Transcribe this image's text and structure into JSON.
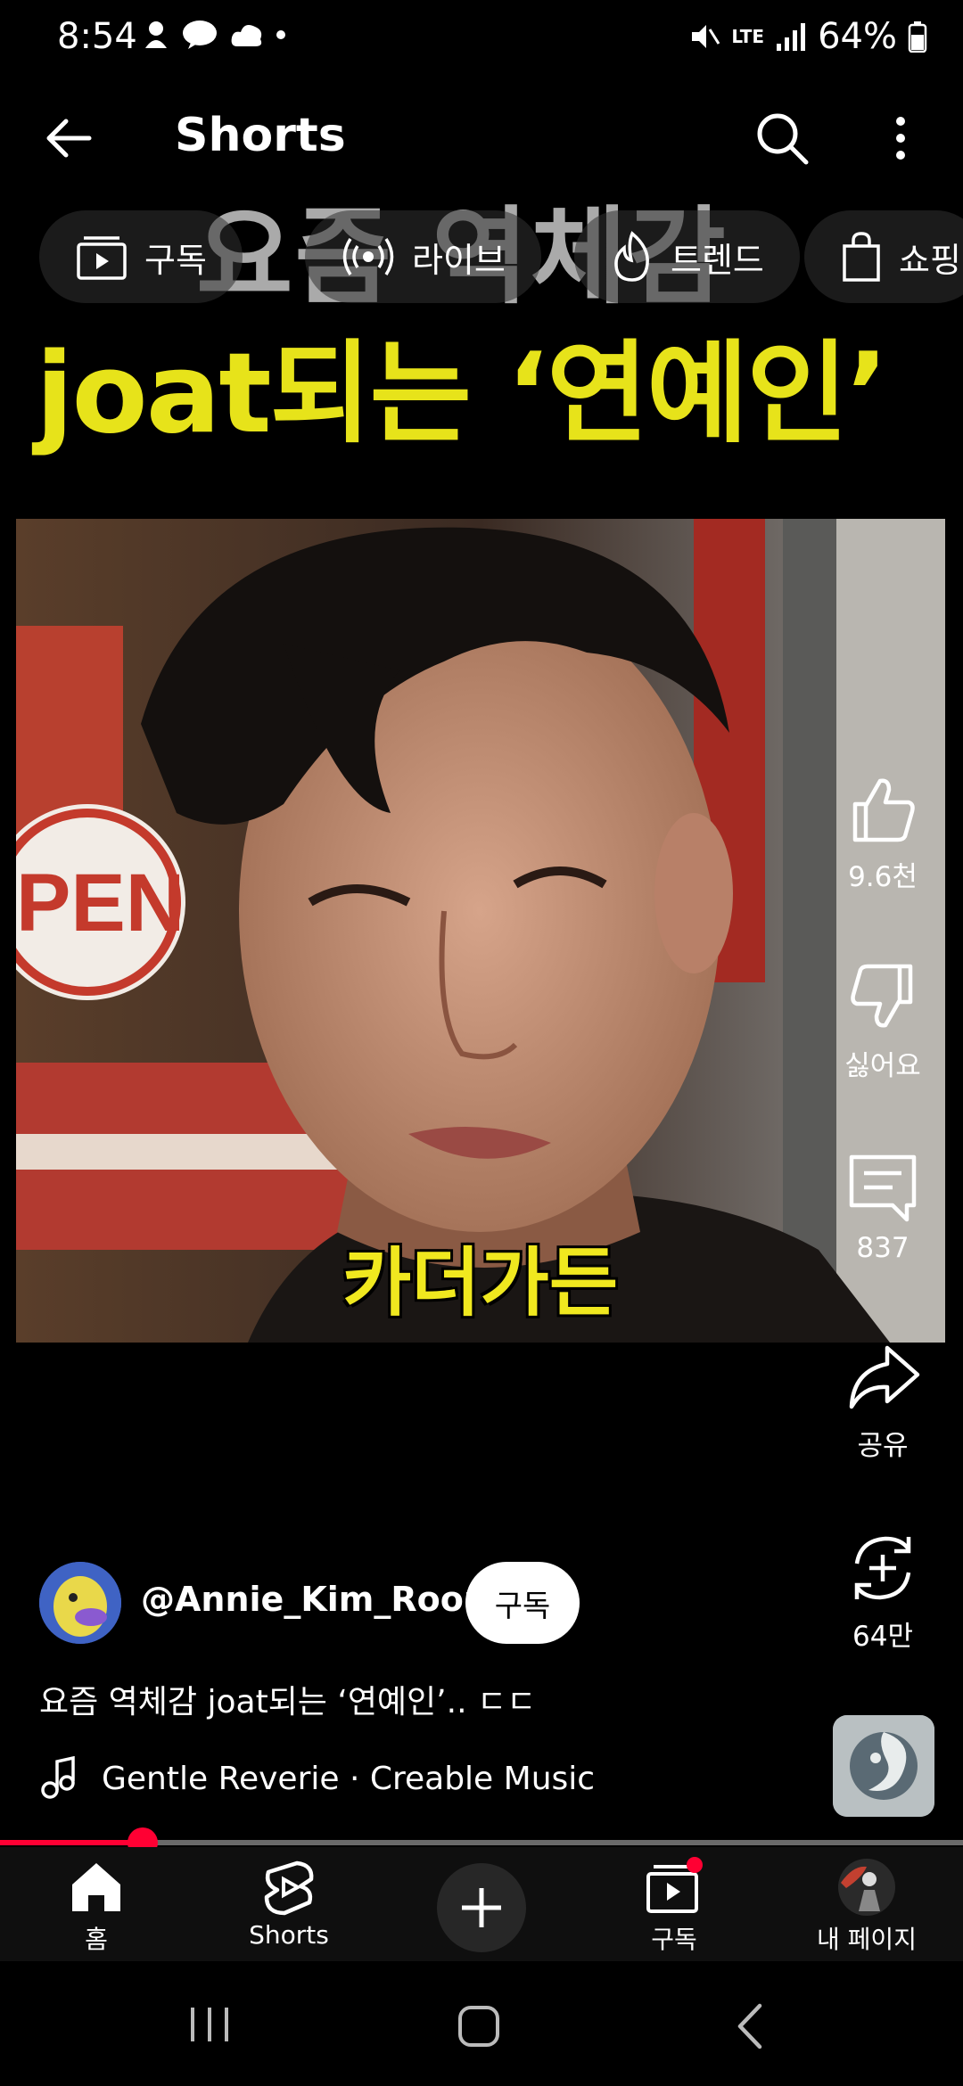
{
  "status_bar": {
    "time": "8:54",
    "network": "LTE",
    "battery": "64%"
  },
  "top_bar": {
    "title": "Shorts"
  },
  "chips": [
    {
      "label": "구독",
      "icon": "subscriptions-icon"
    },
    {
      "label": "라이브",
      "icon": "live-icon"
    },
    {
      "label": "트렌드",
      "icon": "trending-icon"
    },
    {
      "label": "쇼핑",
      "icon": "shopping-bag-icon"
    }
  ],
  "video": {
    "headline_line1": "요즘 역체감",
    "headline_line2": "joat되는 ‘연예인’",
    "caption": "카더가든",
    "bg_sign_text": "PEN"
  },
  "actions": {
    "like_count": "9.6천",
    "dislike_label": "싫어요",
    "comment_count": "837",
    "share_label": "공유",
    "remix_count": "64만"
  },
  "channel": {
    "handle": "@Annie_Kim_Room",
    "subscribe_label": "구독"
  },
  "description": "요즘 역체감 joat되는 ‘연예인’.. ㄷㄷ",
  "music": "Gentle Reverie · Creable Music",
  "progress": 0.148,
  "bottom_nav": {
    "home": "홈",
    "shorts": "Shorts",
    "subscriptions": "구독",
    "my_page": "내 페이지"
  },
  "colors": {
    "accent_red": "#ff0033",
    "headline_yellow": "#e7e31a"
  }
}
